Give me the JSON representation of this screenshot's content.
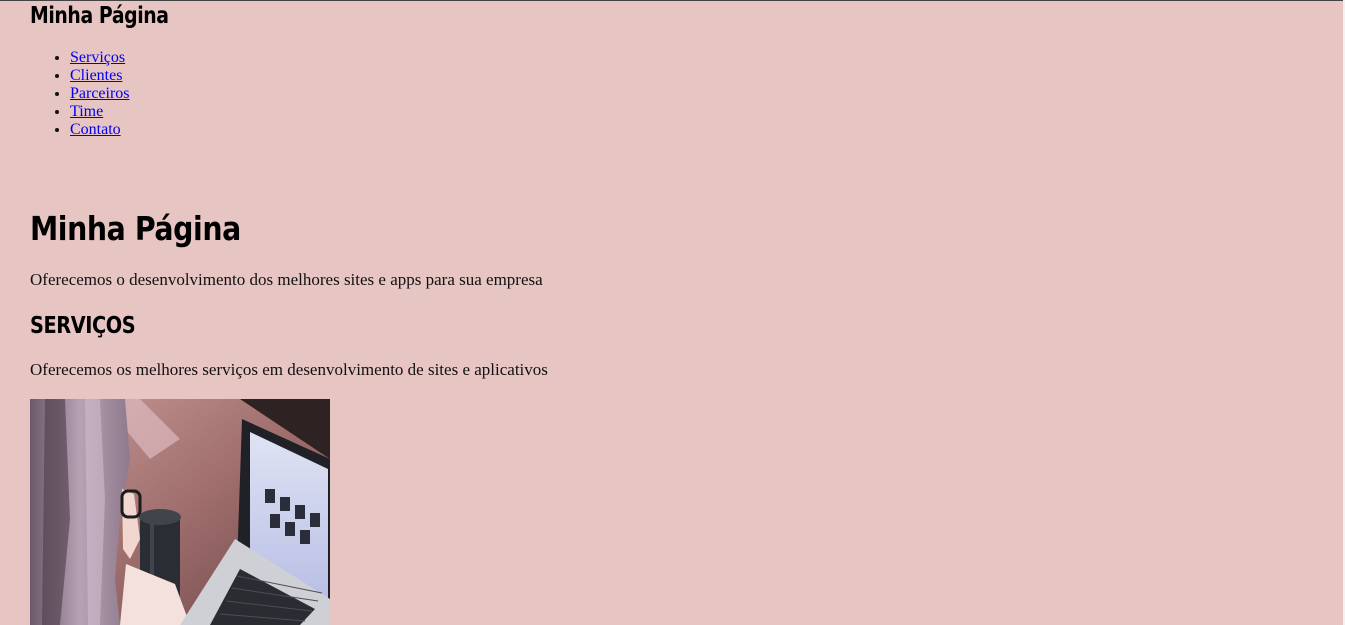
{
  "header": {
    "title": "Minha Página"
  },
  "nav": {
    "items": [
      {
        "label": "Serviços"
      },
      {
        "label": "Clientes"
      },
      {
        "label": "Parceiros"
      },
      {
        "label": "Time"
      },
      {
        "label": "Contato"
      }
    ]
  },
  "hero": {
    "title": "Minha Página",
    "text": "Oferecemos o desenvolvimento dos melhores sites e apps para sua empresa"
  },
  "services": {
    "title": "SERVIÇOS",
    "text": "Oferecemos os melhores serviços em desenvolvimento de sites e aplicativos"
  },
  "colors": {
    "background": "#e7c5c3",
    "link": "#0000ee"
  }
}
